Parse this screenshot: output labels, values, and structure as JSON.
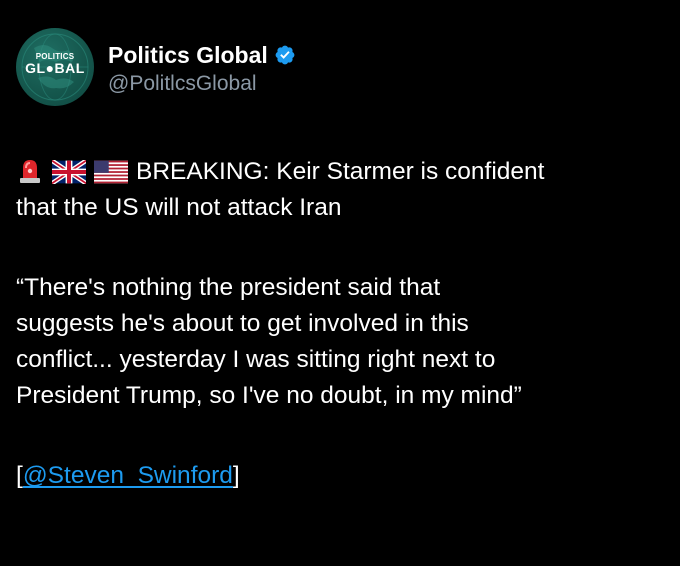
{
  "account": {
    "display_name": "Politics Global",
    "handle": "@PolitlcsGlobal",
    "avatar_text_small": "POLITICS",
    "avatar_text_big": "GL●BAL",
    "verified": true,
    "avatar_color": "#15574d",
    "verified_color": "#1d9bf0"
  },
  "tweet": {
    "icons": [
      "rotating-light-icon",
      "uk-flag-icon",
      "us-flag-icon"
    ],
    "line1": "BREAKING: Keir Starmer is confident",
    "line2": "that the US will not attack Iran",
    "quote_line1": "“There's nothing the president said that",
    "quote_line2": "suggests he's about to get involved in this",
    "quote_line3": "conflict... yesterday I was sitting right next to",
    "quote_line4": "President Trump, so I've no doubt, in my mind”",
    "credit_open": "[",
    "credit_mention": "@Steven_Swinford",
    "credit_close": "]"
  },
  "colors": {
    "background": "#000000",
    "text": "#ffffff",
    "secondary_text": "#8b98a5",
    "link": "#1d9bf0"
  }
}
